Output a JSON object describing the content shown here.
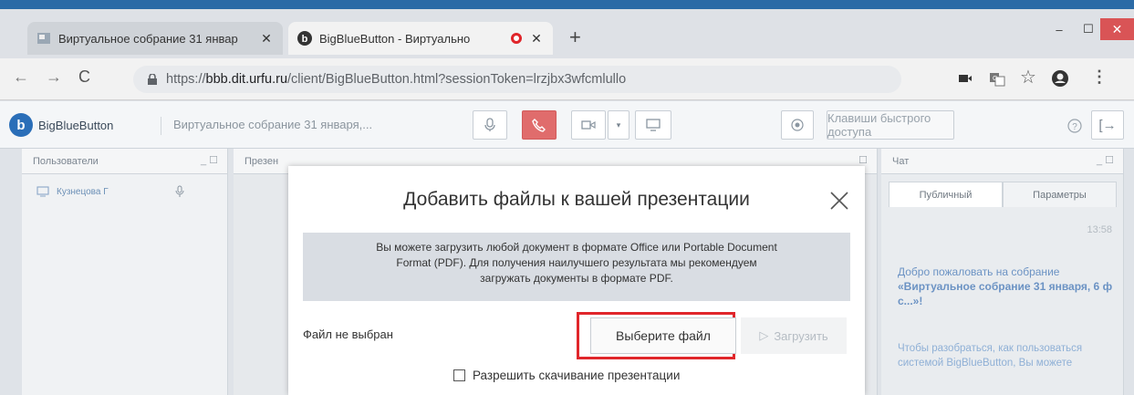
{
  "browser": {
    "tabs": [
      {
        "title": "Виртуальное собрание 31 январ",
        "close": "✕"
      },
      {
        "title": "BigBlueButton - Виртуально",
        "close": "✕"
      }
    ],
    "new_tab": "+",
    "window": {
      "minimize": "–",
      "maximize": "☐",
      "close": "✕"
    },
    "url_prefix": "https://",
    "url_host": "bbb.dit.urfu.ru",
    "url_path": "/client/BigBlueButton.html?sessionToken=lrzjbx3wfcmlullo"
  },
  "bbb": {
    "logo_text": "BigBlueButton",
    "meeting_title": "Виртуальное собрание 31 января,...",
    "hotkeys_label": "Клавиши быстрого доступа"
  },
  "users_panel": {
    "title": "Пользователи",
    "user_name": "Кузнецова Г"
  },
  "presentation_panel": {
    "title": "Презен"
  },
  "chat_panel": {
    "title": "Чат",
    "tab_public": "Публичный",
    "tab_options": "Параметры",
    "time": "13:58",
    "welcome_line1": "Добро пожаловать на собрание",
    "welcome_bold": "«Виртуальное собрание 31 января, 6 ф с...»!",
    "help_text": "Чтобы разобраться, как пользоваться системой BigBlueButton, Вы можете"
  },
  "modal": {
    "title": "Добавить файлы к вашей презентации",
    "notice_lines": [
      "Вы можете загрузить любой документ в формате Office или Portable Document",
      "Format (PDF). Для получения наилучшего результата мы рекомендуем",
      "загружать документы в формате PDF."
    ],
    "file_status": "Файл не выбран",
    "choose_button": "Выберите файл",
    "upload_button": "Загрузить",
    "allow_download": "Разрешить скачивание презентации"
  },
  "colors": {
    "accent": "#2a6eb8",
    "highlight": "#e0262b",
    "call_button": "#e06c6c"
  }
}
